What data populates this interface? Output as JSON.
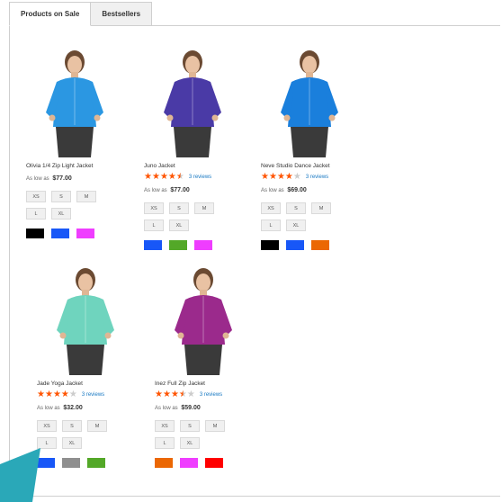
{
  "tabs": [
    {
      "label": "Products on Sale",
      "active": true
    },
    {
      "label": "Bestsellers",
      "active": false
    }
  ],
  "products": [
    {
      "name": "Olivia 1/4 Zip Light Jacket",
      "rating": null,
      "reviews": "",
      "price_prefix": "As low as",
      "price": "$77.00",
      "sizes": [
        "XS",
        "S",
        "M",
        "L",
        "XL"
      ],
      "swatches": [
        "#000000",
        "#1857f7",
        "#ef3dff"
      ],
      "garment_color": "#2b97e2"
    },
    {
      "name": "Juno Jacket",
      "rating": 4.5,
      "reviews": "3 reviews",
      "price_prefix": "As low as",
      "price": "$77.00",
      "sizes": [
        "XS",
        "S",
        "M",
        "L",
        "XL"
      ],
      "swatches": [
        "#1857f7",
        "#53a828",
        "#ef3dff"
      ],
      "garment_color": "#4a3aa6"
    },
    {
      "name": "Neve Studio Dance Jacket",
      "rating": 4,
      "reviews": "3 reviews",
      "price_prefix": "As low as",
      "price": "$69.00",
      "sizes": [
        "XS",
        "S",
        "M",
        "L",
        "XL"
      ],
      "swatches": [
        "#000000",
        "#1857f7",
        "#eb6703"
      ],
      "garment_color": "#1a7fdc"
    },
    {
      "name": "Jade Yoga Jacket",
      "rating": 4,
      "reviews": "3 reviews",
      "price_prefix": "As low as",
      "price": "$32.00",
      "sizes": [
        "XS",
        "S",
        "M",
        "L",
        "XL"
      ],
      "swatches": [
        "#1857f7",
        "#8f8f8f",
        "#53a828"
      ],
      "garment_color": "#6fd4be"
    },
    {
      "name": "Inez Full Zip Jacket",
      "rating": 3.5,
      "reviews": "3 reviews",
      "price_prefix": "As low as",
      "price": "$59.00",
      "sizes": [
        "XS",
        "S",
        "M",
        "L",
        "XL"
      ],
      "swatches": [
        "#eb6703",
        "#ef3dff",
        "#ff0000"
      ],
      "garment_color": "#9b2a8c"
    }
  ],
  "accent_color": "#ff5501",
  "link_color": "#1979c3",
  "corner_color": "#2aa8b8"
}
